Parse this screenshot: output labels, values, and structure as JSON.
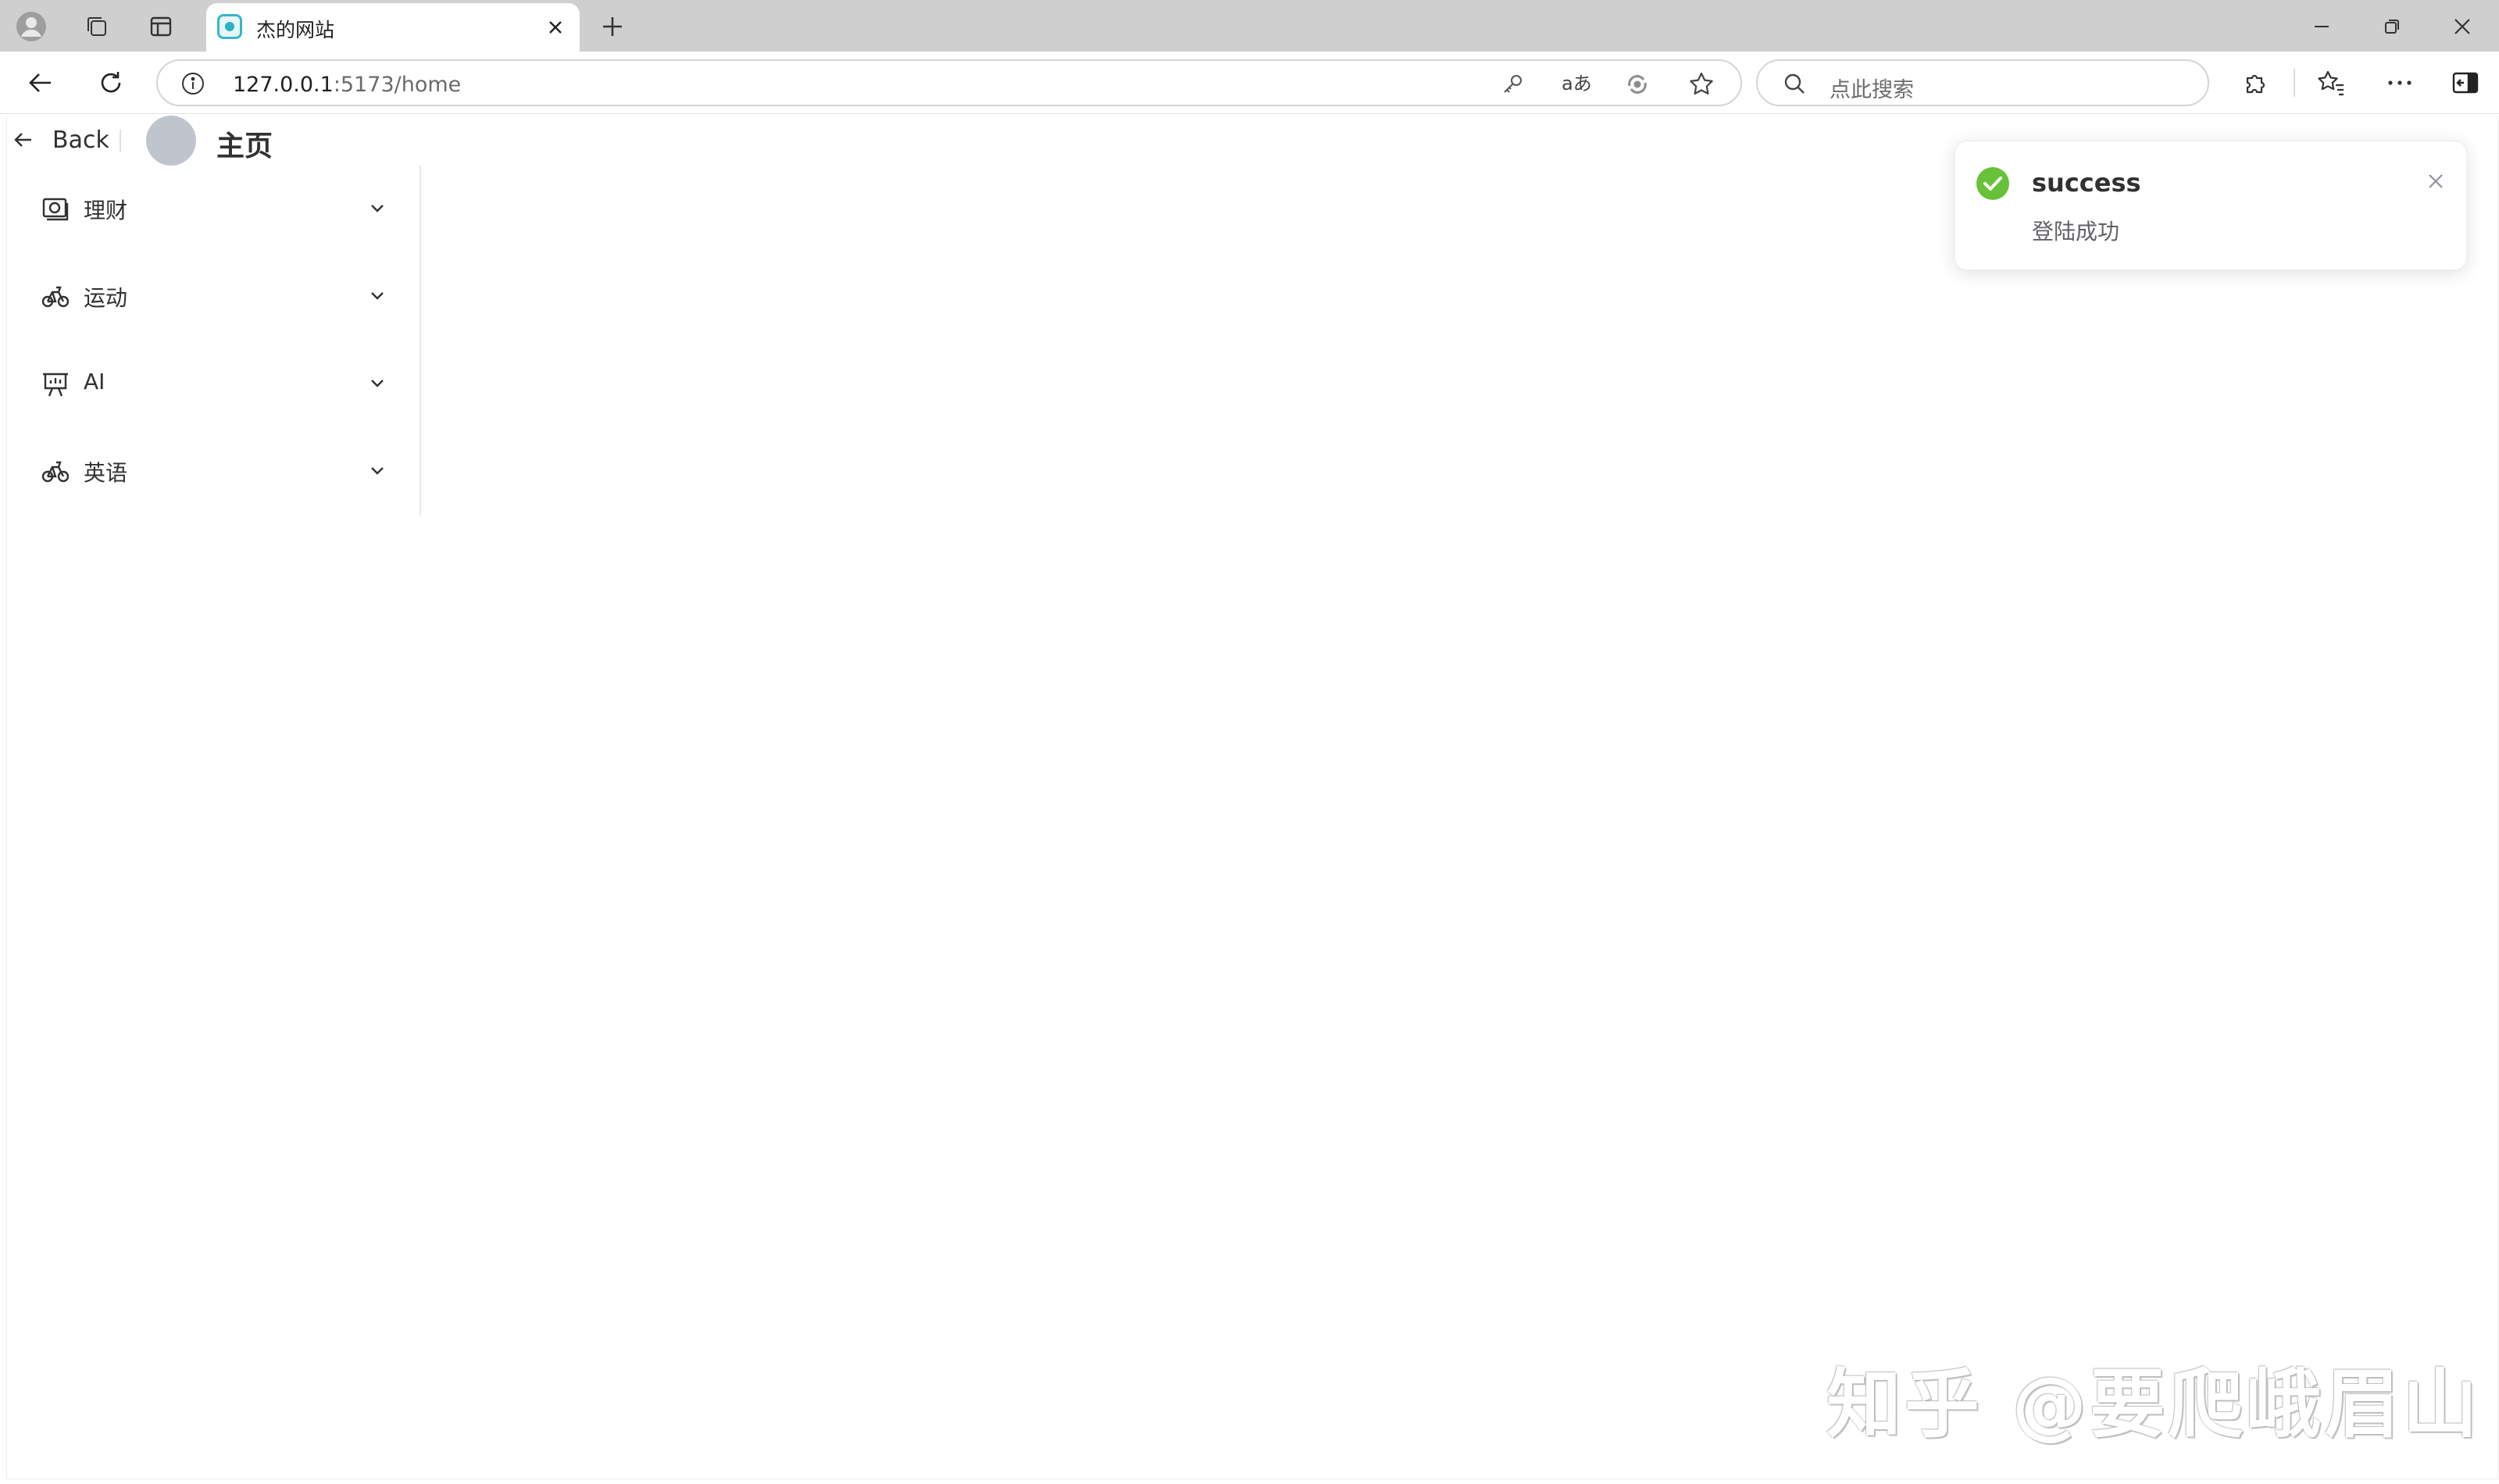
{
  "browser": {
    "tab": {
      "title": "杰的网站"
    },
    "address": {
      "host": "127.0.0.1",
      "path": ":5173/home"
    },
    "search": {
      "placeholder": "点此搜索"
    },
    "icons": {
      "profile": "profile-icon",
      "workspaces": "workspaces-icon",
      "tab_actions": "tab-actions-icon",
      "new_tab": "plus-icon",
      "back": "arrow-left-icon",
      "refresh": "refresh-icon",
      "site_info": "info-icon",
      "password": "key-icon",
      "read_aloud": "translate-icon",
      "copilot": "copilot-icon",
      "favorite": "star-icon",
      "extensions": "puzzle-icon",
      "favorites_bar": "favorites-icon",
      "more": "more-icon",
      "sidebar": "sidebar-icon"
    }
  },
  "page": {
    "header": {
      "back_label": "Back",
      "title": "主页"
    },
    "sidebar": {
      "items": [
        {
          "label": "理财",
          "icon": "money-icon"
        },
        {
          "label": "运动",
          "icon": "bicycle-icon"
        },
        {
          "label": "AI",
          "icon": "presentation-icon"
        },
        {
          "label": "英语",
          "icon": "bicycle-icon"
        }
      ]
    }
  },
  "notification": {
    "title": "success",
    "message": "登陆成功",
    "color": "#67c23a"
  },
  "watermark": {
    "text": "知乎 @要爬峨眉山"
  }
}
